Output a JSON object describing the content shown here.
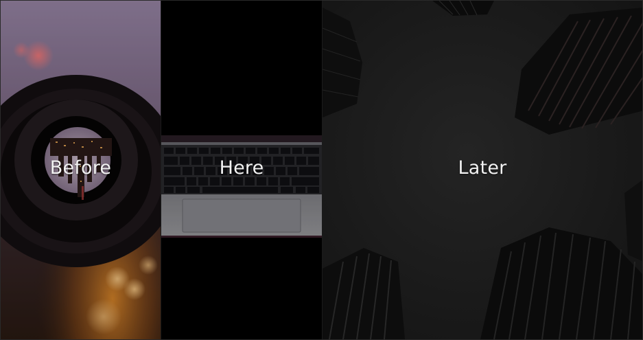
{
  "panels": [
    {
      "id": "before",
      "label": "Before",
      "image": "lens-with-inverted-city-icon"
    },
    {
      "id": "here",
      "label": "Here",
      "image": "laptop-keyboard-icon"
    },
    {
      "id": "later",
      "label": "Later",
      "image": "skyscrapers-upward-view-icon"
    }
  ],
  "colors": {
    "before_sky": "#a790ae",
    "before_warm": "#c87a2a",
    "here_bg": "#000000",
    "later_bg": "#1d1d1d",
    "label": "#f2f2f2"
  }
}
